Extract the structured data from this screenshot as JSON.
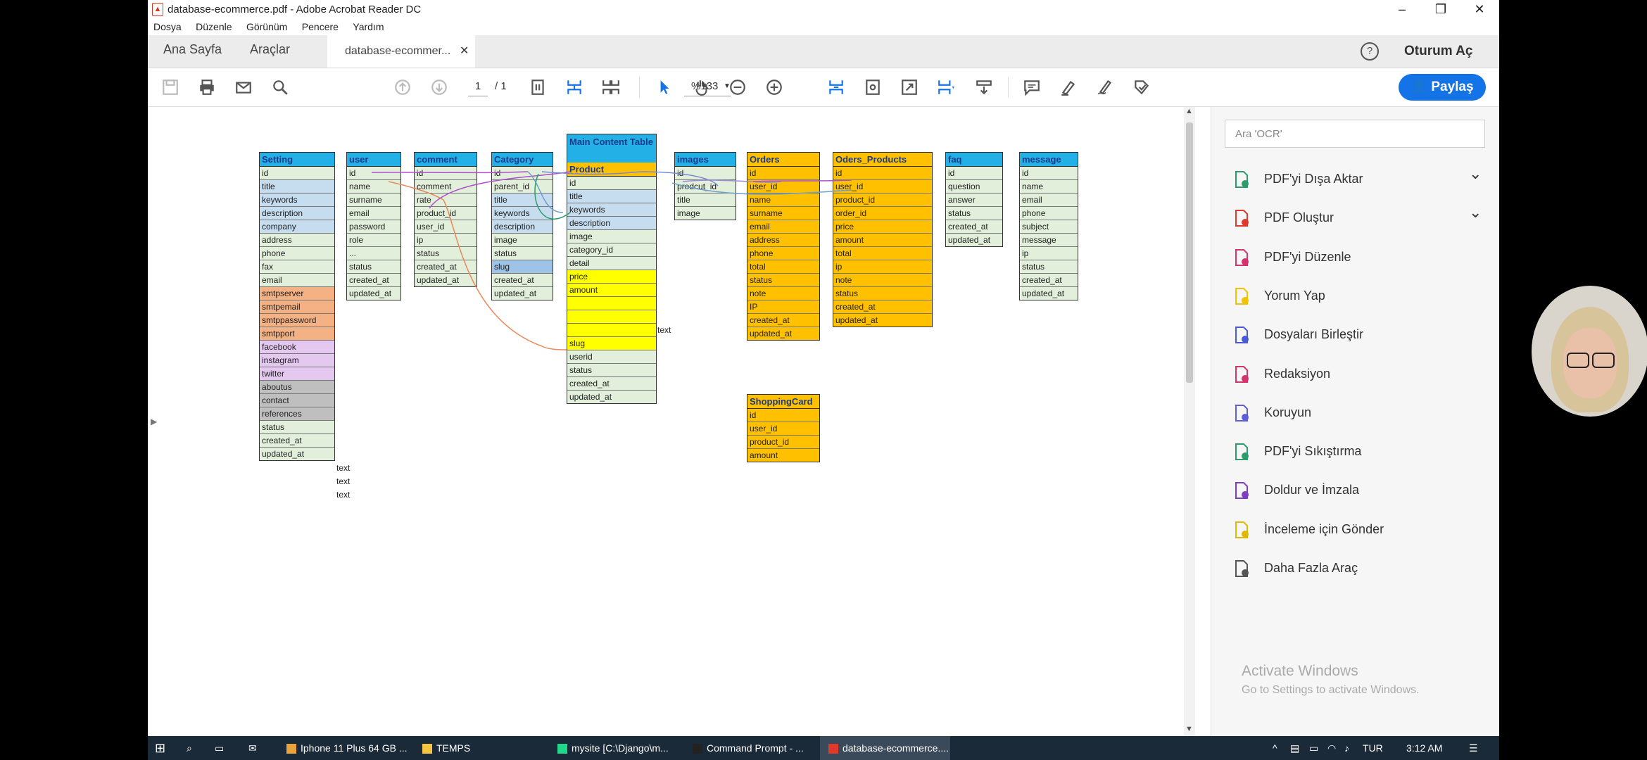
{
  "window": {
    "title": "database-ecommerce.pdf - Adobe Acrobat Reader DC",
    "menu": [
      "Dosya",
      "Düzenle",
      "Görünüm",
      "Pencere",
      "Yardım"
    ]
  },
  "tabs": {
    "home": "Ana Sayfa",
    "tools": "Araçlar",
    "document": "database-ecommer...",
    "help_glyph": "?",
    "sign_in": "Oturum Aç"
  },
  "toolbar": {
    "page_current": "1",
    "page_total": "/ 1",
    "zoom": "%133",
    "share": "Paylaş"
  },
  "diagram": {
    "main_content_label": "Main Content Table",
    "detail_note": "text",
    "tables": [
      {
        "name": "Setting",
        "color": "#23b0e6",
        "rows": [
          {
            "t": "id",
            "c": "#e2efda"
          },
          {
            "t": "title",
            "c": "#c6dcef"
          },
          {
            "t": "keywords",
            "c": "#c6dcef"
          },
          {
            "t": "description",
            "c": "#c6dcef"
          },
          {
            "t": "company",
            "c": "#c6dcef"
          },
          {
            "t": "address",
            "c": "#e2efda"
          },
          {
            "t": "phone",
            "c": "#e2efda"
          },
          {
            "t": "fax",
            "c": "#e2efda"
          },
          {
            "t": "email",
            "c": "#e2efda"
          },
          {
            "t": "smtpserver",
            "c": "#f4b183"
          },
          {
            "t": "smtpemail",
            "c": "#f4b183"
          },
          {
            "t": "smtppassword",
            "c": "#f4b183"
          },
          {
            "t": "smtpport",
            "c": "#f4b183"
          },
          {
            "t": "facebook",
            "c": "#e4c8f0"
          },
          {
            "t": "instagram",
            "c": "#e4c8f0"
          },
          {
            "t": "twitter",
            "c": "#e4c8f0"
          },
          {
            "t": "aboutus",
            "c": "#bfbfbf"
          },
          {
            "t": "contact",
            "c": "#bfbfbf"
          },
          {
            "t": "references",
            "c": "#bfbfbf"
          },
          {
            "t": "status",
            "c": "#e2efda"
          },
          {
            "t": "created_at",
            "c": "#e2efda"
          },
          {
            "t": "updated_at",
            "c": "#e2efda"
          }
        ]
      },
      {
        "name": "user",
        "color": "#23b0e6",
        "rows": [
          {
            "t": "id",
            "c": "#e2efda"
          },
          {
            "t": "name",
            "c": "#e2efda"
          },
          {
            "t": "surname",
            "c": "#e2efda"
          },
          {
            "t": "email",
            "c": "#e2efda"
          },
          {
            "t": "password",
            "c": "#e2efda"
          },
          {
            "t": "role",
            "c": "#e2efda"
          },
          {
            "t": "...",
            "c": "#e2efda"
          },
          {
            "t": "status",
            "c": "#e2efda"
          },
          {
            "t": "created_at",
            "c": "#e2efda"
          },
          {
            "t": "updated_at",
            "c": "#e2efda"
          }
        ]
      },
      {
        "name": "comment",
        "color": "#23b0e6",
        "rows": [
          {
            "t": "id",
            "c": "#e2efda"
          },
          {
            "t": "comment",
            "c": "#e2efda"
          },
          {
            "t": "rate",
            "c": "#e2efda"
          },
          {
            "t": "product_id",
            "c": "#e2efda"
          },
          {
            "t": "user_id",
            "c": "#e2efda"
          },
          {
            "t": "ip",
            "c": "#e2efda"
          },
          {
            "t": "status",
            "c": "#e2efda"
          },
          {
            "t": "created_at",
            "c": "#e2efda"
          },
          {
            "t": "updated_at",
            "c": "#e2efda"
          }
        ]
      },
      {
        "name": "Category",
        "color": "#23b0e6",
        "rows": [
          {
            "t": "id",
            "c": "#e2efda"
          },
          {
            "t": "parent_id",
            "c": "#e2efda"
          },
          {
            "t": "title",
            "c": "#c6dcef"
          },
          {
            "t": "keywords",
            "c": "#c6dcef"
          },
          {
            "t": "description",
            "c": "#c6dcef"
          },
          {
            "t": "image",
            "c": "#e2efda"
          },
          {
            "t": "status",
            "c": "#e2efda"
          },
          {
            "t": "slug",
            "c": "#9ec3e6"
          },
          {
            "t": "created_at",
            "c": "#e2efda"
          },
          {
            "t": "updated_at",
            "c": "#e2efda"
          }
        ]
      },
      {
        "name": "Product",
        "color": "#ffc000",
        "rows": [
          {
            "t": "id",
            "c": "#e2efda"
          },
          {
            "t": "title",
            "c": "#c6dcef"
          },
          {
            "t": "keywords",
            "c": "#c6dcef"
          },
          {
            "t": "description",
            "c": "#c6dcef"
          },
          {
            "t": "image",
            "c": "#e2efda"
          },
          {
            "t": "category_id",
            "c": "#e2efda"
          },
          {
            "t": "detail",
            "c": "#e2efda"
          },
          {
            "t": "price",
            "c": "#ffff00"
          },
          {
            "t": "amount",
            "c": "#ffff00"
          },
          {
            "t": "",
            "c": "#ffff00"
          },
          {
            "t": "",
            "c": "#ffff00"
          },
          {
            "t": "",
            "c": "#ffff00"
          },
          {
            "t": "slug",
            "c": "#ffff00"
          },
          {
            "t": "userid",
            "c": "#e2efda"
          },
          {
            "t": "status",
            "c": "#e2efda"
          },
          {
            "t": "created_at",
            "c": "#e2efda"
          },
          {
            "t": "updated_at",
            "c": "#e2efda"
          }
        ]
      },
      {
        "name": "images",
        "color": "#23b0e6",
        "rows": [
          {
            "t": "id",
            "c": "#e2efda"
          },
          {
            "t": "prodcut_id",
            "c": "#e2efda"
          },
          {
            "t": "title",
            "c": "#e2efda"
          },
          {
            "t": "image",
            "c": "#e2efda"
          }
        ]
      },
      {
        "name": "Orders",
        "color": "#ffc000",
        "rows": [
          {
            "t": "id",
            "c": "#ffc000"
          },
          {
            "t": "user_id",
            "c": "#ffc000"
          },
          {
            "t": "name",
            "c": "#ffc000"
          },
          {
            "t": "surname",
            "c": "#ffc000"
          },
          {
            "t": "email",
            "c": "#ffc000"
          },
          {
            "t": "address",
            "c": "#ffc000"
          },
          {
            "t": "phone",
            "c": "#ffc000"
          },
          {
            "t": "total",
            "c": "#ffc000"
          },
          {
            "t": "status",
            "c": "#ffc000"
          },
          {
            "t": "note",
            "c": "#ffc000"
          },
          {
            "t": "IP",
            "c": "#ffc000"
          },
          {
            "t": "created_at",
            "c": "#ffc000"
          },
          {
            "t": "updated_at",
            "c": "#ffc000"
          }
        ]
      },
      {
        "name": "Oders_Products",
        "color": "#ffc000",
        "rows": [
          {
            "t": "id",
            "c": "#ffc000"
          },
          {
            "t": "user_id",
            "c": "#ffc000"
          },
          {
            "t": "product_id",
            "c": "#ffc000"
          },
          {
            "t": "order_id",
            "c": "#ffc000"
          },
          {
            "t": "price",
            "c": "#ffc000"
          },
          {
            "t": "amount",
            "c": "#ffc000"
          },
          {
            "t": "total",
            "c": "#ffc000"
          },
          {
            "t": "ip",
            "c": "#ffc000"
          },
          {
            "t": "note",
            "c": "#ffc000"
          },
          {
            "t": "status",
            "c": "#ffc000"
          },
          {
            "t": "created_at",
            "c": "#ffc000"
          },
          {
            "t": "updated_at",
            "c": "#ffc000"
          }
        ]
      },
      {
        "name": "faq",
        "color": "#23b0e6",
        "rows": [
          {
            "t": "id",
            "c": "#e2efda"
          },
          {
            "t": "question",
            "c": "#e2efda"
          },
          {
            "t": "answer",
            "c": "#e2efda"
          },
          {
            "t": "status",
            "c": "#e2efda"
          },
          {
            "t": "created_at",
            "c": "#e2efda"
          },
          {
            "t": "updated_at",
            "c": "#e2efda"
          }
        ]
      },
      {
        "name": "message",
        "color": "#23b0e6",
        "rows": [
          {
            "t": "id",
            "c": "#e2efda"
          },
          {
            "t": "name",
            "c": "#e2efda"
          },
          {
            "t": "email",
            "c": "#e2efda"
          },
          {
            "t": "phone",
            "c": "#e2efda"
          },
          {
            "t": "subject",
            "c": "#e2efda"
          },
          {
            "t": "message",
            "c": "#e2efda"
          },
          {
            "t": "ip",
            "c": "#e2efda"
          },
          {
            "t": "status",
            "c": "#e2efda"
          },
          {
            "t": "created_at",
            "c": "#e2efda"
          },
          {
            "t": "updated_at",
            "c": "#e2efda"
          }
        ]
      },
      {
        "name": "ShoppingCard",
        "color": "#ffc000",
        "rows": [
          {
            "t": "id",
            "c": "#ffc000"
          },
          {
            "t": "user_id",
            "c": "#ffc000"
          },
          {
            "t": "product_id",
            "c": "#ffc000"
          },
          {
            "t": "amount",
            "c": "#ffc000"
          }
        ]
      }
    ]
  },
  "right_panel": {
    "search_placeholder": "Ara 'OCR'",
    "tools": [
      {
        "label": "PDF'yi Dışa Aktar",
        "icon": "export-pdf-icon",
        "color": "#2d9c6a",
        "chevron": true
      },
      {
        "label": "PDF Oluştur",
        "icon": "create-pdf-icon",
        "color": "#e0392b",
        "chevron": true
      },
      {
        "label": "PDF'yi Düzenle",
        "icon": "edit-pdf-icon",
        "color": "#d6336c",
        "chevron": false
      },
      {
        "label": "Yorum Yap",
        "icon": "comment-icon",
        "color": "#f2c200",
        "chevron": false
      },
      {
        "label": "Dosyaları Birleştir",
        "icon": "combine-files-icon",
        "color": "#4a5ad8",
        "chevron": false
      },
      {
        "label": "Redaksiyon",
        "icon": "redact-icon",
        "color": "#d6336c",
        "chevron": false
      },
      {
        "label": "Koruyun",
        "icon": "protect-icon",
        "color": "#5b5fd8",
        "chevron": false
      },
      {
        "label": "PDF'yi Sıkıştırma",
        "icon": "compress-pdf-icon",
        "color": "#2d9c6a",
        "chevron": false
      },
      {
        "label": "Doldur ve İmzala",
        "icon": "fill-sign-icon",
        "color": "#7a3fc2",
        "chevron": false
      },
      {
        "label": "İnceleme için Gönder",
        "icon": "send-review-icon",
        "color": "#e0b800",
        "chevron": false
      },
      {
        "label": "Daha Fazla Araç",
        "icon": "more-tools-icon",
        "color": "#555555",
        "chevron": false
      }
    ],
    "activate_title": "Activate Windows",
    "activate_sub": "Go to Settings to activate Windows."
  },
  "taskbar": {
    "items": [
      {
        "label": "Iphone 11 Plus 64 GB ...",
        "icon": "chrome-icon",
        "color": "#e8a33d"
      },
      {
        "label": "TEMPS",
        "icon": "folder-icon",
        "color": "#f5c542"
      },
      {
        "label": "mysite [C:\\Django\\m...",
        "icon": "pycharm-icon",
        "color": "#21d789"
      },
      {
        "label": "Command Prompt - ...",
        "icon": "cmd-icon",
        "color": "#222222"
      },
      {
        "label": "database-ecommerce....",
        "icon": "acrobat-icon",
        "color": "#e0392b"
      }
    ],
    "lang": "TUR",
    "time": "3:12 AM"
  }
}
